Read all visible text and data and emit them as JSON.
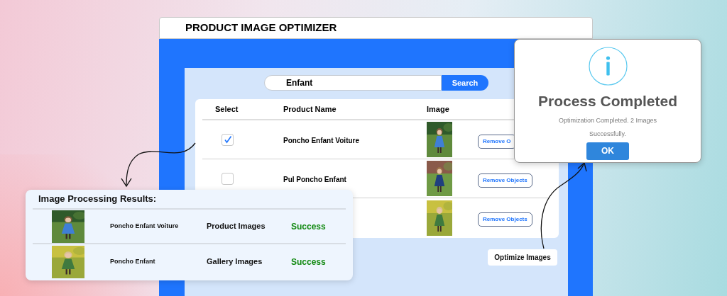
{
  "window": {
    "title": "PRODUCT IMAGE OPTIMIZER"
  },
  "search": {
    "value": "Enfant",
    "button": "Search"
  },
  "table": {
    "columns": [
      "Select",
      "Product Name",
      "Image"
    ],
    "rows": [
      {
        "checked": true,
        "name": "Poncho Enfant Voiture",
        "action": "Remove O"
      },
      {
        "checked": false,
        "name": "Pul Poncho Enfant",
        "action": "Remove Objects"
      },
      {
        "action": "Remove Objects"
      }
    ]
  },
  "results": {
    "title": "Image Processing Results:",
    "rows": [
      {
        "name": "Poncho Enfant Voiture",
        "category": "Product Images",
        "status": "Success"
      },
      {
        "name": "Poncho Enfant",
        "category": "Gallery Images",
        "status": "Success"
      }
    ]
  },
  "dialog": {
    "title": "Process Completed",
    "message": "Optimization Completed. 2 Images Successfully.",
    "button": "OK"
  },
  "callout": "Optimize Images"
}
